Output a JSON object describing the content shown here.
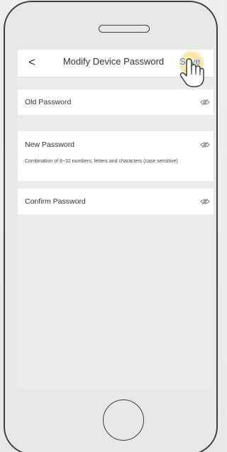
{
  "header": {
    "back_icon": "chevron-left-icon",
    "title": "Modify Device Password",
    "save_label": "Save"
  },
  "fields": {
    "old_password": {
      "label": "Old Password",
      "toggle_icon": "eye-hidden-icon"
    },
    "new_password": {
      "label": "New Password",
      "toggle_icon": "eye-hidden-icon",
      "hint": "Combination of 8~32 numbers, letters and characters (case sensitive)"
    },
    "confirm_password": {
      "label": "Confirm Password",
      "toggle_icon": "eye-hidden-icon"
    }
  },
  "colors": {
    "accent": "#3a8ad8",
    "tap_highlight": "#ffd156",
    "screen_background": "#ebebeb",
    "frame": "#3e3e3e"
  }
}
